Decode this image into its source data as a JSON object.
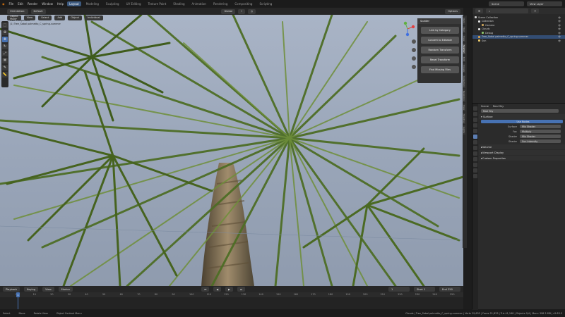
{
  "topbar": {
    "menus": [
      "File",
      "Edit",
      "Render",
      "Window",
      "Help"
    ],
    "workspaces": [
      "Layout",
      "Modeling",
      "Sculpting",
      "UV Editing",
      "Texture Paint",
      "Shading",
      "Animation",
      "Rendering",
      "Compositing",
      "Scripting"
    ],
    "active_workspace": "Layout",
    "scene_label": "Scene",
    "view_layer_label": "View Layer"
  },
  "viewport_header": {
    "orientation_label": "Orientation:",
    "orientation_value": "Default",
    "mode": "Object Mode",
    "view": "View",
    "select": "Select",
    "add": "Add",
    "object": "Object",
    "pivot": "Individual",
    "transform": "Global",
    "options": "Options"
  },
  "viewport_overlay": {
    "line1": "User Perspective",
    "line2": "(1) Tree_Sabal palmetto_C_spring-summer"
  },
  "scatter_panel": {
    "title": "Scatter",
    "buttons": [
      "Link by Category",
      "Convert to Editable",
      "Random Transform",
      "Reset Transform",
      "Find Missing Files"
    ]
  },
  "side_tabs": [
    "Item",
    "Tool",
    "View",
    "Scatter",
    "Edit",
    "Create",
    "Collection",
    "Relations",
    "View",
    "Shading",
    "Lights"
  ],
  "timeline": {
    "menus": [
      "Playback",
      "Keying",
      "View",
      "Marker"
    ],
    "current_frame": "1",
    "start_label": "Start",
    "start": "1",
    "end_label": "End",
    "end": "250",
    "ticks": [
      "0",
      "10",
      "20",
      "30",
      "40",
      "50",
      "60",
      "70",
      "80",
      "90",
      "100",
      "110",
      "120",
      "130",
      "140",
      "150",
      "160",
      "170",
      "180",
      "190",
      "200",
      "210",
      "220",
      "230",
      "240",
      "250"
    ]
  },
  "statusbar": {
    "select": "Select",
    "move": "Move",
    "rotate": "Rotate View",
    "context": "Object Context Menu",
    "info": "Clouds | Tree_Sabal palmetto_C_spring-summer | Verts 29,633 | Faces 21,833 | Tris 41,168 | Objects 0/4 | Mem: 398.3 MB | v2.83.3"
  },
  "outliner": {
    "rows": [
      {
        "label": "Scene Collection",
        "indent": 0
      },
      {
        "label": "Collection",
        "indent": 1
      },
      {
        "label": "Camera",
        "indent": 2
      },
      {
        "label": "Clouds",
        "indent": 1
      },
      {
        "label": "Debug",
        "indent": 2
      },
      {
        "label": "Tree_Sabal palmetto_C_spring-summer",
        "indent": 1,
        "selected": true
      },
      {
        "label": "Sun",
        "indent": 1
      }
    ]
  },
  "properties": {
    "scene_tab": "Scene",
    "world_tab": "Real Sky",
    "world_name": "Real Sky",
    "surface_section": "Surface",
    "use_nodes": "Use Nodes",
    "rows": [
      {
        "label": "Surface",
        "value": "Mix Shader"
      },
      {
        "label": "Fac",
        "value": "Multiply"
      },
      {
        "label": "Shader",
        "value": "Mix Shader"
      },
      {
        "label": "Shader",
        "value": "Sun Intensity"
      }
    ],
    "sections": [
      "Volume",
      "Viewport Display",
      "Custom Properties"
    ]
  },
  "colors": {
    "accent": "#4772b3",
    "sky_top": "#a9b4c6",
    "leaf_dark": "#3b5a1e",
    "leaf_light": "#6f8f3a",
    "trunk": "#7a6a55"
  }
}
